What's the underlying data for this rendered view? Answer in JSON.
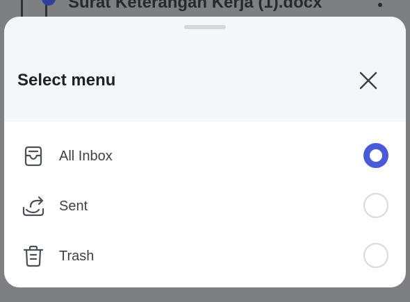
{
  "background": {
    "file_title": "Surat Keterangan Kerja (1).docx"
  },
  "sheet": {
    "title": "Select menu",
    "options": [
      {
        "label": "All Inbox",
        "icon": "inbox-icon",
        "selected": true
      },
      {
        "label": "Sent",
        "icon": "sent-icon",
        "selected": false
      },
      {
        "label": "Trash",
        "icon": "trash-icon",
        "selected": false
      }
    ]
  },
  "colors": {
    "accent": "#4a59d6",
    "overlay": "#7d7f83",
    "header_bg": "#f4f6f9"
  }
}
